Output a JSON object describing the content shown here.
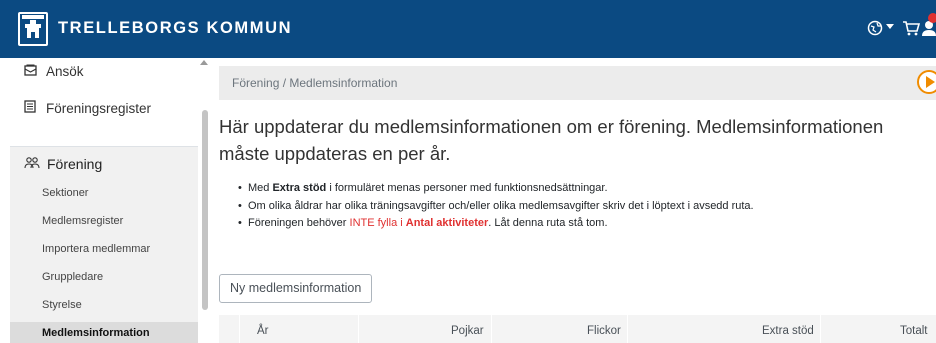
{
  "app": {
    "brand": "TRELLEBORGS KOMMUN"
  },
  "topbar_icons": [
    "globe-icon",
    "cart-icon",
    "user-icon"
  ],
  "sidebar": {
    "top_items": [
      {
        "label": "Ansök",
        "icon": "envelope-icon"
      },
      {
        "label": "Föreningsregister",
        "icon": "list-icon"
      }
    ],
    "group": {
      "label": "Förening",
      "icon": "users-icon",
      "items": [
        {
          "label": "Sektioner"
        },
        {
          "label": "Medlemsregister"
        },
        {
          "label": "Importera medlemmar"
        },
        {
          "label": "Gruppledare"
        },
        {
          "label": "Styrelse"
        },
        {
          "label": "Medlemsinformation",
          "active": true
        }
      ]
    }
  },
  "breadcrumb": "Förening / Medlemsinformation",
  "heading": "Här uppdaterar du medlemsinformationen om er förening. Medlemsinformationen måste uppdateras en per år.",
  "bullets": {
    "b1_pre": "Med ",
    "b1_bold": "Extra stöd",
    "b1_post": " i formuläret menas personer med funktionsnedsättningar.",
    "b2": "Om olika åldrar har olika träningsavgifter och/eller olika medlemsavgifter skriv det i löptext i avsedd ruta.",
    "b3_pre": "Föreningen behöver ",
    "b3_red": "INTE fylla i ",
    "b3_redbold": "Antal aktiviteter",
    "b3_post": ". Låt denna ruta stå tom."
  },
  "new_button": "Ny medlemsinformation",
  "table": {
    "columns": [
      "År",
      "Pojkar",
      "Flickor",
      "Extra stöd",
      "Totalt"
    ]
  },
  "colors": {
    "topbar": "#0b4a82",
    "accent_orange": "#f08c00",
    "warning_red": "#e03131"
  }
}
